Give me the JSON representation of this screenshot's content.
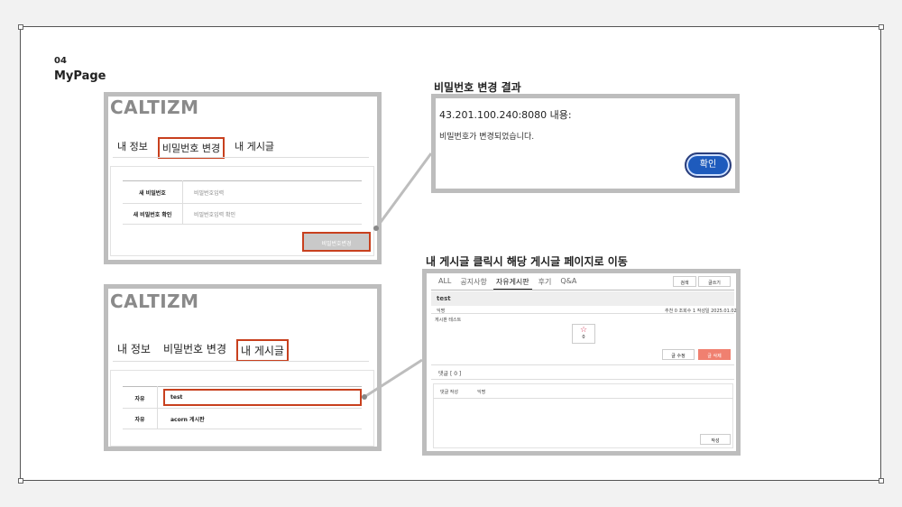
{
  "section": {
    "number": "04",
    "title": "MyPage"
  },
  "top_panel": {
    "brand": "CALTIZM",
    "tabs": [
      "내 정보",
      "비밀번호 변경",
      "내 게시글"
    ],
    "form": {
      "new_pw_label": "새 비밀번호",
      "new_pw_placeholder": "비밀번호입력",
      "confirm_label": "새 비밀번호 확인",
      "confirm_placeholder": "비밀번호입력 확인",
      "submit": "비밀번호변경"
    }
  },
  "bottom_panel": {
    "brand": "CALTIZM",
    "tabs": [
      "내 정보",
      "비밀번호 변경",
      "내 게시글"
    ],
    "posts": [
      {
        "category": "자유",
        "title": "test"
      },
      {
        "category": "자유",
        "title": "acorn 게시판"
      }
    ]
  },
  "alert": {
    "heading": "비밀번호 변경 결과",
    "host": "43.201.100.240:8080 내용:",
    "message": "비밀번호가 변경되었습니다.",
    "ok": "확인"
  },
  "board": {
    "heading": "내 게시글 클릭시 해당 게시글 페이지로 이동",
    "tabs": [
      "ALL",
      "공지사항",
      "자유게시판",
      "후기",
      "Q&A"
    ],
    "search": "검색",
    "write": "글쓰기",
    "post_title": "test",
    "author": "익명",
    "meta": "추천 0   조회수 1   작성일 2025.01.02",
    "content": "게시판 테스트",
    "like_count": "0",
    "edit": "글 수정",
    "delete": "글 삭제",
    "comments_label": "댓글 [ 0 ]",
    "comment_write_label": "댓글 작성",
    "comment_author": "익명",
    "comment_submit": "작성"
  },
  "colors": {
    "highlight": "#c8401e",
    "ok_button": "#1e5bbd",
    "frame": "#bdbdbd",
    "delete_button": "#f08070"
  }
}
